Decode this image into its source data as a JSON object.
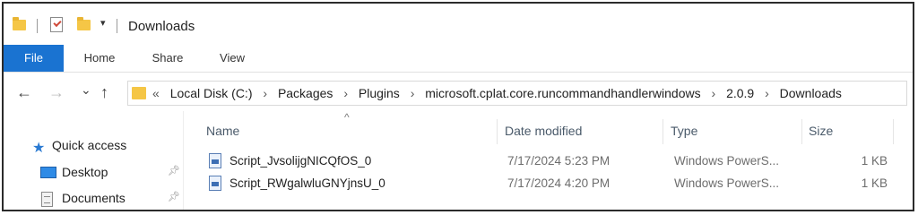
{
  "window": {
    "title": "Downloads",
    "quick_access_toolbar": {
      "icons": [
        "folder-icon",
        "properties-icon",
        "new-folder-icon"
      ],
      "customize_arrow": "▾"
    }
  },
  "ribbon": {
    "tabs": [
      {
        "label": "File",
        "active": true
      },
      {
        "label": "Home"
      },
      {
        "label": "Share"
      },
      {
        "label": "View"
      }
    ],
    "file_tab_color": "#1a73d1"
  },
  "navigation": {
    "back": "←",
    "forward": "→",
    "recent": "⌄",
    "up": "↑",
    "overflow": "«",
    "separator": "›",
    "breadcrumbs": [
      "Local Disk (C:)",
      "Packages",
      "Plugins",
      "microsoft.cplat.core.runcommandhandlerwindows",
      "2.0.9",
      "Downloads"
    ]
  },
  "nav_pane": {
    "items": [
      {
        "label": "Quick access",
        "icon": "star-icon"
      },
      {
        "label": "Desktop",
        "icon": "desktop-icon",
        "pinned": true
      },
      {
        "label": "Documents",
        "icon": "documents-icon",
        "pinned": true
      }
    ]
  },
  "file_list": {
    "columns": [
      "Name",
      "Date modified",
      "Type",
      "Size"
    ],
    "sort_indicator": "^",
    "rows": [
      {
        "name": "Script_JvsolijgNICQfOS_0",
        "date": "7/17/2024 5:23 PM",
        "type": "Windows PowerS...",
        "size": "1 KB",
        "icon": "powershell-script-icon"
      },
      {
        "name": "Script_RWgalwluGNYjnsU_0",
        "date": "7/17/2024 4:20 PM",
        "type": "Windows PowerS...",
        "size": "1 KB",
        "icon": "powershell-script-icon"
      }
    ]
  }
}
